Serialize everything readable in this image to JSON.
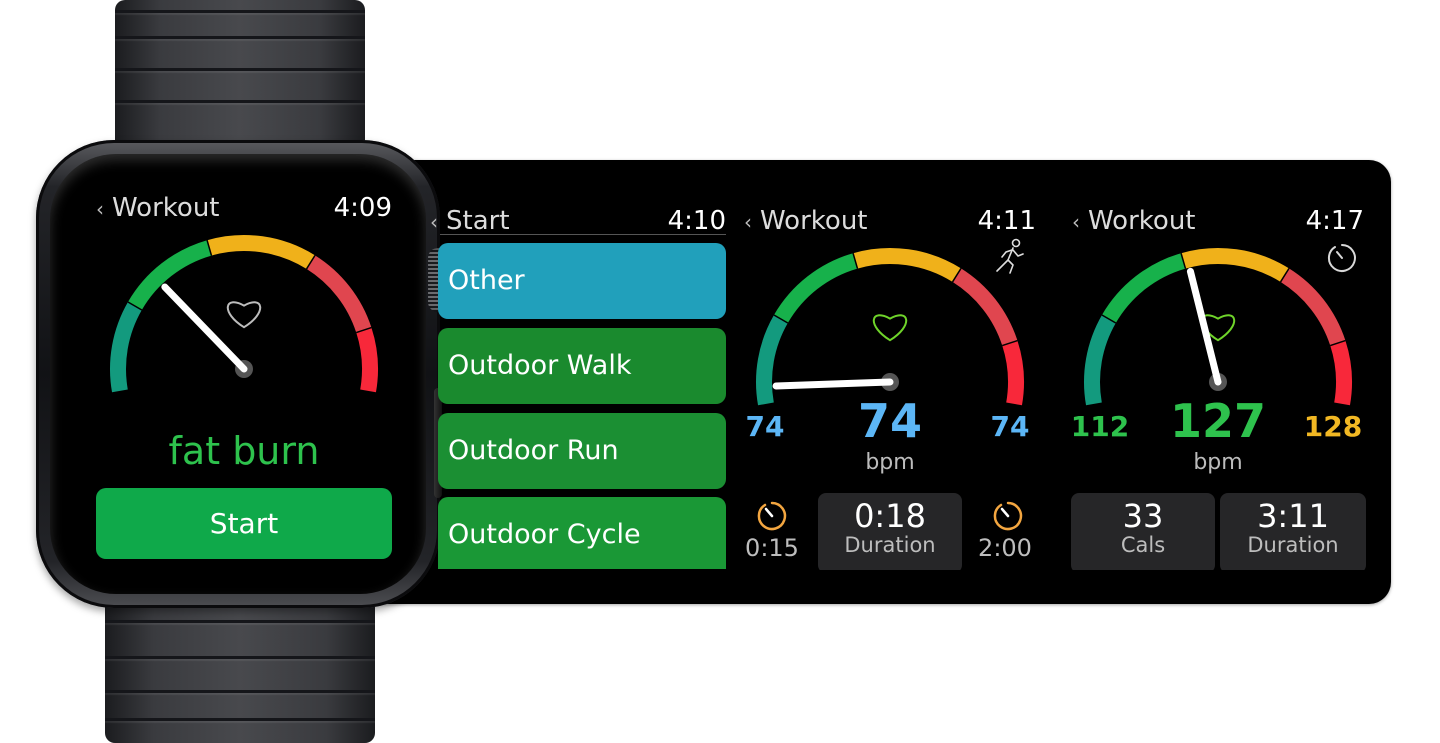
{
  "colors": {
    "zone_teal": "#139a7e",
    "zone_green": "#17b14b",
    "zone_yellow": "#f0b11a",
    "zone_salmon": "#e0464f",
    "zone_red": "#f8283a",
    "start_green": "#0fa94a",
    "list_blue": "#21a0bb",
    "list_green": "#1a8a2e",
    "value_blue": "#5cb6f6",
    "value_green": "#2ec24d",
    "value_yellow": "#f2b823",
    "timer_orange": "#f3a640",
    "heart_green": "#6fd42a"
  },
  "screens": [
    {
      "id": "zone-select",
      "header": {
        "back_glyph": "‹",
        "title": "Workout",
        "time": "4:09"
      },
      "gauge": {
        "needle_fraction": 0.28,
        "heart_icon": "heart-outline-icon"
      },
      "zone_label": "fat burn",
      "start_button": "Start"
    },
    {
      "id": "workout-type",
      "header": {
        "back_glyph": "‹",
        "title": "Start",
        "time": "4:10"
      },
      "items": [
        {
          "label": "Other",
          "color": "#21a0bb"
        },
        {
          "label": "Outdoor Walk",
          "color": "#1a8a2e"
        },
        {
          "label": "Outdoor Run",
          "color": "#1b8f33"
        },
        {
          "label": "Outdoor Cycle",
          "color": "#1a9836"
        }
      ]
    },
    {
      "id": "workout-warmup",
      "header": {
        "back_glyph": "‹",
        "title": "Workout",
        "time": "4:11"
      },
      "status_icon": "running-man-icon",
      "gauge": {
        "needle_fraction": 0.04
      },
      "min_value": "74",
      "current_value": "74",
      "max_value": "74",
      "unit": "bpm",
      "timer_left": "0:15",
      "timer_right": "2:00",
      "tile": {
        "value": "0:18",
        "label": "Duration"
      }
    },
    {
      "id": "workout-active",
      "header": {
        "back_glyph": "‹",
        "title": "Workout",
        "time": "4:17"
      },
      "status_icon": "stopwatch-icon",
      "gauge": {
        "needle_fraction": 0.43
      },
      "min_value": "112",
      "current_value": "127",
      "max_value": "128",
      "unit": "bpm",
      "tiles": [
        {
          "value": "33",
          "label": "Cals"
        },
        {
          "value": "3:11",
          "label": "Duration"
        }
      ]
    }
  ]
}
